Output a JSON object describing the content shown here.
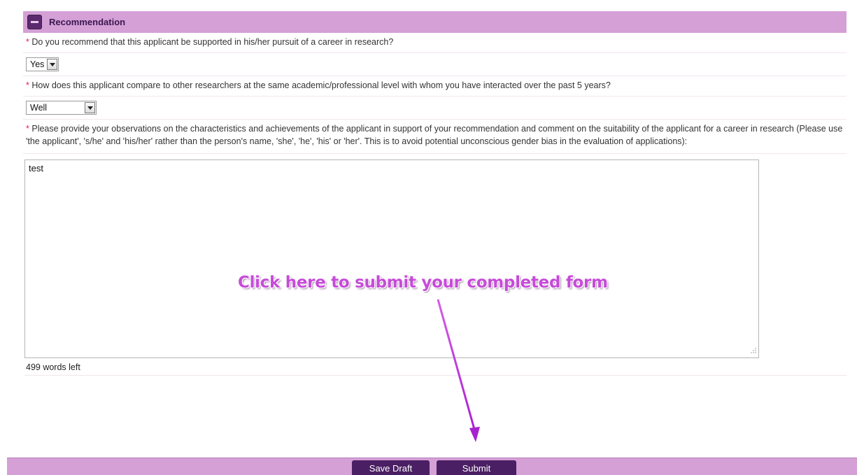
{
  "section": {
    "title": "Recommendation"
  },
  "questions": [
    {
      "required_mark": "*",
      "text": "Do you recommend that this applicant be supported in his/her pursuit of a career in research?",
      "selected": "Yes"
    },
    {
      "required_mark": "*",
      "text": "How does this applicant compare to other researchers at the same academic/professional level with whom you have interacted over the past 5 years?",
      "selected": "Well"
    },
    {
      "required_mark": "*",
      "text": "Please provide your observations on the characteristics and achievements of the applicant in support of your recommendation and comment on the suitability of the applicant for a career in research (Please use 'the applicant', 's/he' and 'his/her' rather than the person's name, 'she', 'he', 'his' or 'her'. This is to avoid potential unconscious gender bias in the evaluation of applications):",
      "textarea_value": "test",
      "words_left": "499 words left"
    }
  ],
  "annotation": {
    "text": "Click here to submit your completed form"
  },
  "footer": {
    "save_draft_label": "Save Draft",
    "submit_label": "Submit"
  },
  "colors": {
    "header_bg": "#d4a0d6",
    "button_bg": "#4a1f63",
    "annotation": "#c64bd8",
    "required": "#d9265a"
  }
}
